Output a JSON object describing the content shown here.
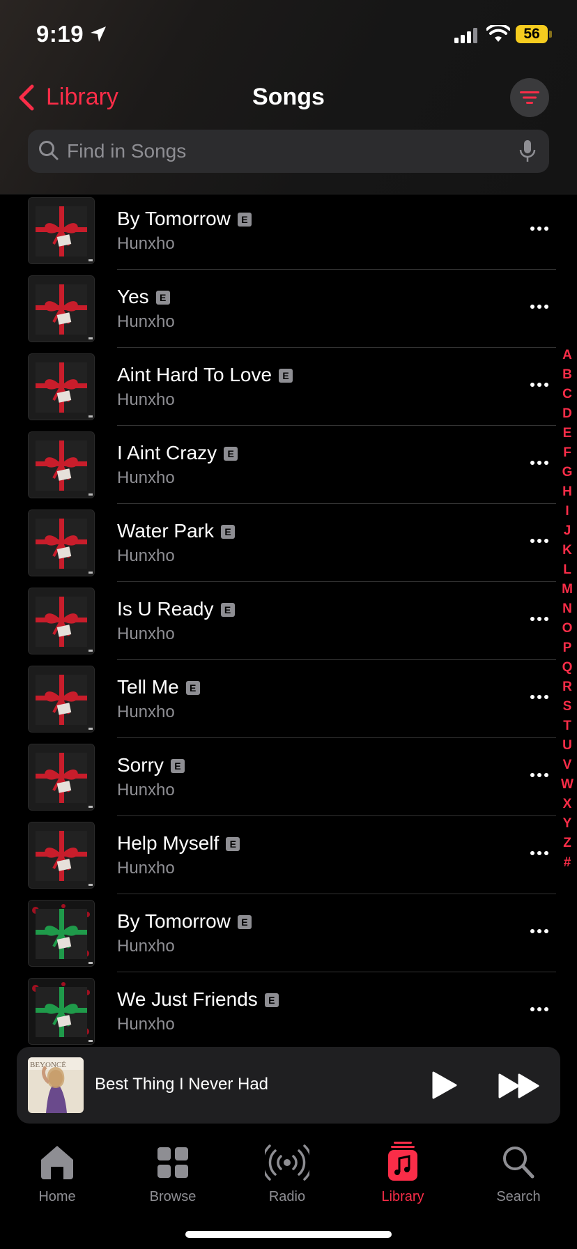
{
  "status_bar": {
    "time": "9:19",
    "battery": "56"
  },
  "nav": {
    "back_label": "Library",
    "title": "Songs"
  },
  "search": {
    "placeholder": "Find in Songs",
    "value": ""
  },
  "songs": [
    {
      "title": "By Tomorrow",
      "artist": "Hunxho",
      "explicit": "E",
      "art": "red-bow"
    },
    {
      "title": "Yes",
      "artist": "Hunxho",
      "explicit": "E",
      "art": "red-bow"
    },
    {
      "title": "Aint Hard To Love",
      "artist": "Hunxho",
      "explicit": "E",
      "art": "red-bow"
    },
    {
      "title": "I Aint Crazy",
      "artist": "Hunxho",
      "explicit": "E",
      "art": "red-bow"
    },
    {
      "title": "Water Park",
      "artist": "Hunxho",
      "explicit": "E",
      "art": "red-bow"
    },
    {
      "title": "Is U Ready",
      "artist": "Hunxho",
      "explicit": "E",
      "art": "red-bow"
    },
    {
      "title": "Tell Me",
      "artist": "Hunxho",
      "explicit": "E",
      "art": "red-bow"
    },
    {
      "title": "Sorry",
      "artist": "Hunxho",
      "explicit": "E",
      "art": "red-bow"
    },
    {
      "title": "Help Myself",
      "artist": "Hunxho",
      "explicit": "E",
      "art": "red-bow"
    },
    {
      "title": "By Tomorrow",
      "artist": "Hunxho",
      "explicit": "E",
      "art": "green-bow"
    },
    {
      "title": "We Just Friends",
      "artist": "Hunxho",
      "explicit": "E",
      "art": "green-bow"
    }
  ],
  "index_letters": [
    "A",
    "B",
    "C",
    "D",
    "E",
    "F",
    "G",
    "H",
    "I",
    "J",
    "K",
    "L",
    "M",
    "N",
    "O",
    "P",
    "Q",
    "R",
    "S",
    "T",
    "U",
    "V",
    "W",
    "X",
    "Y",
    "Z",
    "#"
  ],
  "now_playing": {
    "title": "Best Thing I Never Had",
    "art_text": "BEYONCÉ"
  },
  "tabs": [
    {
      "label": "Home",
      "icon": "house-icon",
      "active": false
    },
    {
      "label": "Browse",
      "icon": "grid-icon",
      "active": false
    },
    {
      "label": "Radio",
      "icon": "radio-icon",
      "active": false
    },
    {
      "label": "Library",
      "icon": "music-note-icon",
      "active": true
    },
    {
      "label": "Search",
      "icon": "search-icon",
      "active": false
    }
  ],
  "colors": {
    "accent": "#fa2d48",
    "secondary_text": "#8e8e93",
    "battery": "#f5cc1f",
    "background": "#000000"
  }
}
